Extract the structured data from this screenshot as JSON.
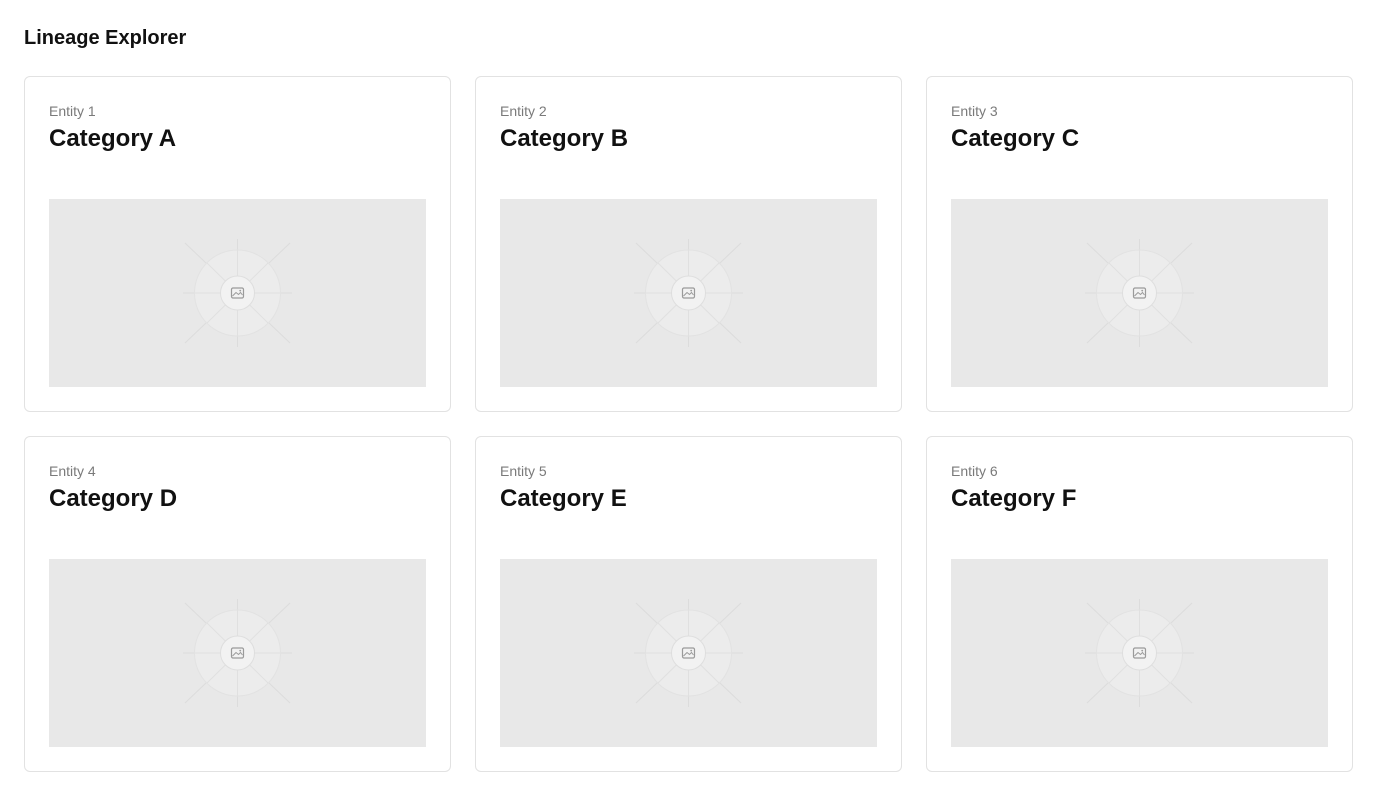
{
  "page": {
    "title": "Lineage Explorer"
  },
  "cards": [
    {
      "kicker": "Entity 1",
      "title": "Category A",
      "media_icon": "image-placeholder-icon"
    },
    {
      "kicker": "Entity 2",
      "title": "Category B",
      "media_icon": "image-placeholder-icon"
    },
    {
      "kicker": "Entity 3",
      "title": "Category C",
      "media_icon": "image-placeholder-icon"
    },
    {
      "kicker": "Entity 4",
      "title": "Category D",
      "media_icon": "image-placeholder-icon"
    },
    {
      "kicker": "Entity 5",
      "title": "Category E",
      "media_icon": "image-placeholder-icon"
    },
    {
      "kicker": "Entity 6",
      "title": "Category F",
      "media_icon": "image-placeholder-icon"
    }
  ],
  "colors": {
    "card_border": "#e2e2e2",
    "media_background": "#e8e8e8",
    "kicker_text": "#7a7a7a",
    "title_text": "#111111"
  }
}
